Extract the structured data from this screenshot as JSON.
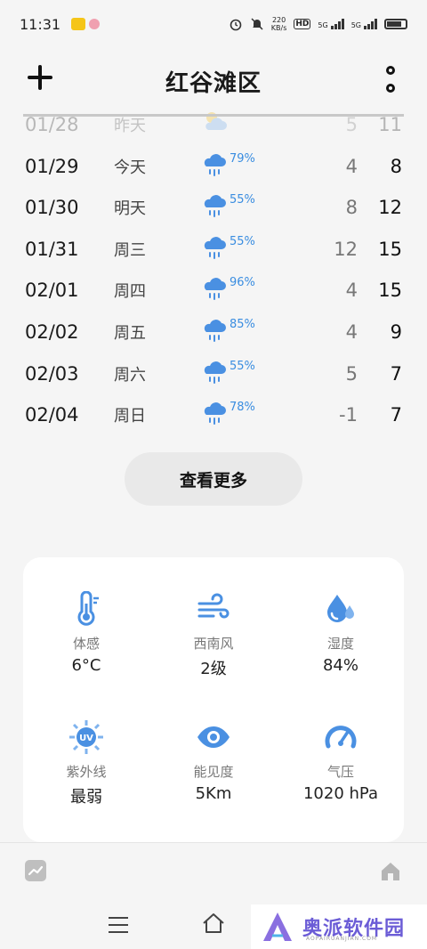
{
  "status_bar": {
    "time": "11:31",
    "net_rate_value": "220",
    "net_rate_unit": "KB/s",
    "hd_label": "HD",
    "sig_label_1": "5G",
    "sig_label_2": "5G"
  },
  "header": {
    "title": "红谷滩区"
  },
  "forecast": [
    {
      "date": "01/28",
      "day": "昨天",
      "icon": "partly-cloudy-icon",
      "precip": "",
      "low": "5",
      "high": "11"
    },
    {
      "date": "01/29",
      "day": "今天",
      "icon": "rain-icon",
      "precip": "79%",
      "low": "4",
      "high": "8"
    },
    {
      "date": "01/30",
      "day": "明天",
      "icon": "rain-icon",
      "precip": "55%",
      "low": "8",
      "high": "12"
    },
    {
      "date": "01/31",
      "day": "周三",
      "icon": "rain-icon",
      "precip": "55%",
      "low": "12",
      "high": "15"
    },
    {
      "date": "02/01",
      "day": "周四",
      "icon": "rain-icon",
      "precip": "96%",
      "low": "4",
      "high": "15"
    },
    {
      "date": "02/02",
      "day": "周五",
      "icon": "rain-icon",
      "precip": "85%",
      "low": "4",
      "high": "9"
    },
    {
      "date": "02/03",
      "day": "周六",
      "icon": "rain-icon",
      "precip": "55%",
      "low": "5",
      "high": "7"
    },
    {
      "date": "02/04",
      "day": "周日",
      "icon": "rain-icon",
      "precip": "78%",
      "low": "-1",
      "high": "7"
    }
  ],
  "more_button_label": "查看更多",
  "details": [
    {
      "icon": "thermometer-icon",
      "label": "体感",
      "value": "6°C"
    },
    {
      "icon": "wind-icon",
      "label": "西南风",
      "value": "2级"
    },
    {
      "icon": "humidity-icon",
      "label": "湿度",
      "value": "84%"
    },
    {
      "icon": "uv-icon",
      "label": "紫外线",
      "value": "最弱"
    },
    {
      "icon": "visibility-icon",
      "label": "能见度",
      "value": "5Km"
    },
    {
      "icon": "pressure-icon",
      "label": "气压",
      "value": "1020 hPa"
    }
  ],
  "colors": {
    "accent_blue": "#3a8de0",
    "icon_blue": "#4a90e2"
  },
  "watermark": {
    "text": "奥派软件园",
    "sub": "AOPAIRUANJIAN.COM"
  }
}
